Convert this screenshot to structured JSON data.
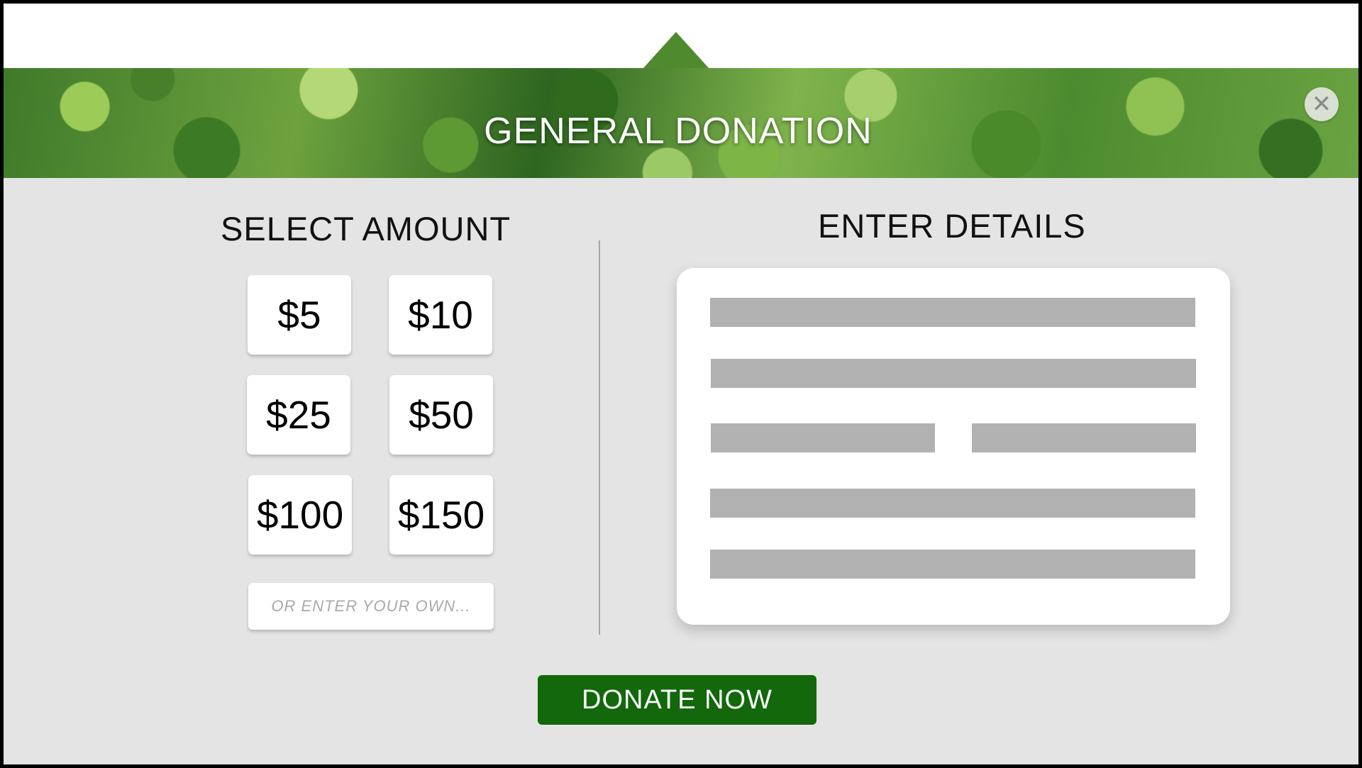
{
  "banner": {
    "title": "GENERAL DONATION",
    "close_glyph": "✕",
    "close_icon": "close-icon"
  },
  "amount_section": {
    "title": "SELECT AMOUNT",
    "options": [
      "$5",
      "$10",
      "$25",
      "$50",
      "$100",
      "$150"
    ],
    "custom_placeholder": "OR ENTER YOUR OWN..."
  },
  "details_section": {
    "title": "ENTER DETAILS"
  },
  "donate_button": {
    "label": "DONATE NOW"
  },
  "colors": {
    "background": "#e4e4e4",
    "donate_button": "#12680a",
    "field_placeholder": "#b1b1b1",
    "card": "#ffffff"
  }
}
